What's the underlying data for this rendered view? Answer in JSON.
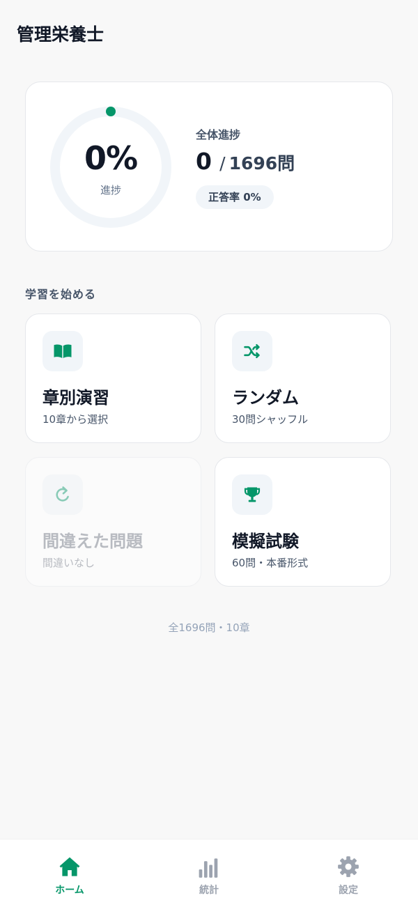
{
  "app": {
    "title": "管理栄養士"
  },
  "progress": {
    "percent_label": "0%",
    "percent_value": 0,
    "ring_caption": "進捗",
    "overall_label": "全体進捗",
    "answered": "0",
    "separator": "/",
    "total_label": "1696問",
    "accuracy_label": "正答率 0%"
  },
  "section": {
    "heading": "学習を始める"
  },
  "modes": [
    {
      "title": "章別演習",
      "subtitle": "10章から選択",
      "icon": "book-icon",
      "enabled": true
    },
    {
      "title": "ランダム",
      "subtitle": "30問シャッフル",
      "icon": "shuffle-icon",
      "enabled": true
    },
    {
      "title": "間違えた問題",
      "subtitle": "間違いなし",
      "icon": "retry-icon",
      "enabled": false
    },
    {
      "title": "模擬試験",
      "subtitle": "60問・本番形式",
      "icon": "trophy-icon",
      "enabled": true
    }
  ],
  "footer": {
    "note": "全1696問・10章"
  },
  "tabs": [
    {
      "label": "ホーム",
      "icon": "home-icon",
      "active": true
    },
    {
      "label": "統計",
      "icon": "bar-chart-icon",
      "active": false
    },
    {
      "label": "設定",
      "icon": "gear-icon",
      "active": false
    }
  ],
  "colors": {
    "accent": "#059669",
    "ring_track": "#f1f5f9",
    "text_primary": "#111827",
    "text_muted": "#94a3b8",
    "background": "#f8f8f8"
  }
}
